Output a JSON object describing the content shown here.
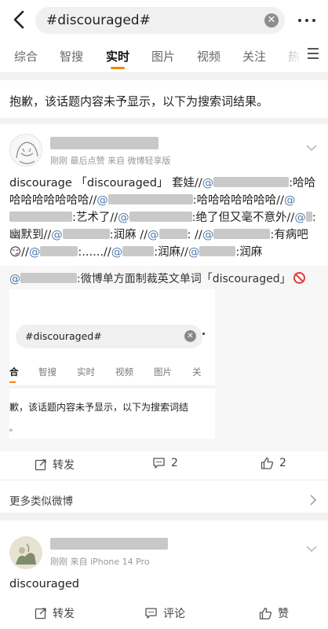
{
  "search": {
    "query": "#discouraged#"
  },
  "tabs": [
    "综合",
    "智搜",
    "实时",
    "图片",
    "视频",
    "关注",
    "热"
  ],
  "notice": "抱歉，该话题内容未予显示，以下为搜索词结果。",
  "post1": {
    "meta": "刚刚 最后点赞  来自 微博轻享版",
    "seg": [
      "discourage 「discouraged」 套娃//",
      "@",
      ":哈哈哈哈哈哈哈哈哈//",
      "@",
      ":哈哈哈哈哈哈哈//",
      "@",
      ":艺术了//",
      "@",
      ":绝了但又毫不意外//",
      "@",
      ":幽默到//",
      "@",
      ":润麻 //",
      "@",
      ": //",
      "@",
      ":有病吧",
      "😏",
      "//",
      "@",
      ":......//",
      "@",
      ":润麻//",
      "@",
      ":润麻"
    ],
    "repost_prefix": "@",
    "repost_text": ":微博单方面制裁英文单词「discouraged」",
    "inner": {
      "query": "#discouraged#",
      "tabs": [
        "合",
        "智搜",
        "实时",
        "视频",
        "图片",
        "关"
      ],
      "notice": "歉，该话题内容未予显示，以下为搜索词结",
      "dot": "。"
    },
    "actions": {
      "repost": "转发",
      "comment": "2",
      "like": "2"
    },
    "similar": "更多类似微博"
  },
  "post2": {
    "meta": "刚刚  来自 iPhone 14 Pro",
    "text": "discouraged",
    "actions": {
      "repost": "转发",
      "comment": "评论",
      "like": "赞"
    }
  },
  "colors": {
    "accent": "#ff8200",
    "mention": "#4f7cae",
    "block": "#e23b3b"
  }
}
